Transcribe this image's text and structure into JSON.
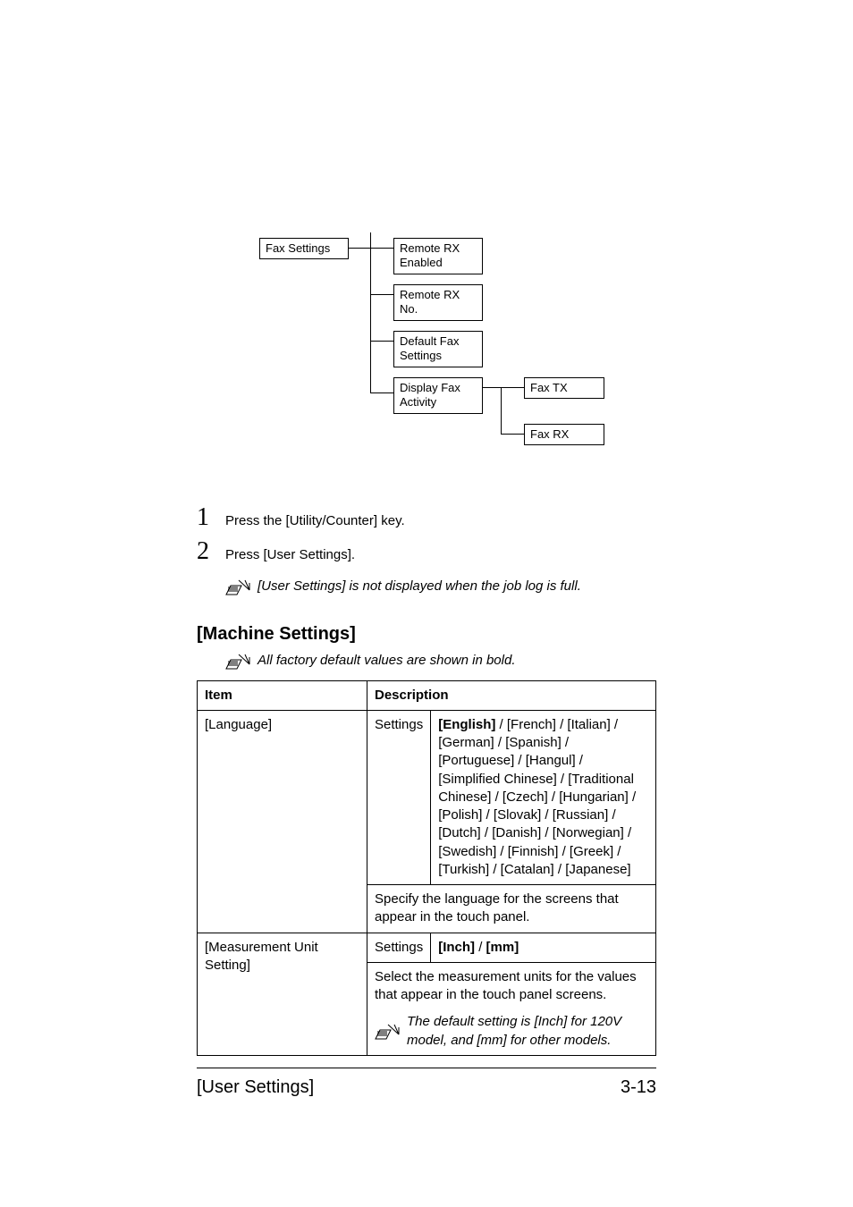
{
  "flowchart": {
    "root": "Fax Settings",
    "col2": {
      "a": "Remote RX Enabled",
      "b": "Remote RX No.",
      "c": "Default Fax Settings",
      "d": "Display Fax Activity"
    },
    "col3": {
      "a": "Fax TX",
      "b": "Fax RX"
    }
  },
  "steps": {
    "s1": "Press the [Utility/Counter] key.",
    "s2": "Press [User Settings].",
    "note": "[User Settings] is not displayed when the job log is full."
  },
  "section_heading": "[Machine Settings]",
  "section_note": "All factory default values are shown in bold.",
  "table": {
    "header": {
      "item": "Item",
      "desc": "Description"
    },
    "row1": {
      "item": "[Language]",
      "settings_label": "Settings",
      "settings_value": "[English] / [French] / [Italian] / [German] / [Spanish] / [Portuguese] / [Hangul] / [Simplified Chinese] / [Traditional Chinese] / [Czech] / [Hungarian] / [Polish] / [Slovak] / [Russian] / [Dutch] / [Danish] / [Norwegian] / [Swedish] / [Finnish] / [Greek] / [Turkish] / [Catalan] / [Japanese]",
      "settings_value_bold": "[English]",
      "settings_value_rest": " / [French] / [Italian] / [German] / [Spanish] / [Portuguese] / [Hangul] / [Simplified Chinese] / [Traditional Chinese] / [Czech] / [Hungarian] / [Polish] / [Slovak] / [Russian] / [Dutch] / [Danish] / [Norwegian] / [Swedish] / [Finnish] / [Greek] / [Turkish] / [Catalan] / [Japanese]",
      "desc": "Specify the language for the screens that appear in the touch panel."
    },
    "row2": {
      "item": "[Measurement Unit Setting]",
      "settings_label": "Settings",
      "settings_value_bold": "[Inch]",
      "settings_value_mid": " / ",
      "settings_value_bold2": "[mm]",
      "desc": "Select the measurement units for the values that appear in the touch panel screens.",
      "note": "The default setting is [Inch] for 120V model, and [mm] for other models."
    }
  },
  "footer": {
    "left": "[User Settings]",
    "right": "3-13"
  }
}
